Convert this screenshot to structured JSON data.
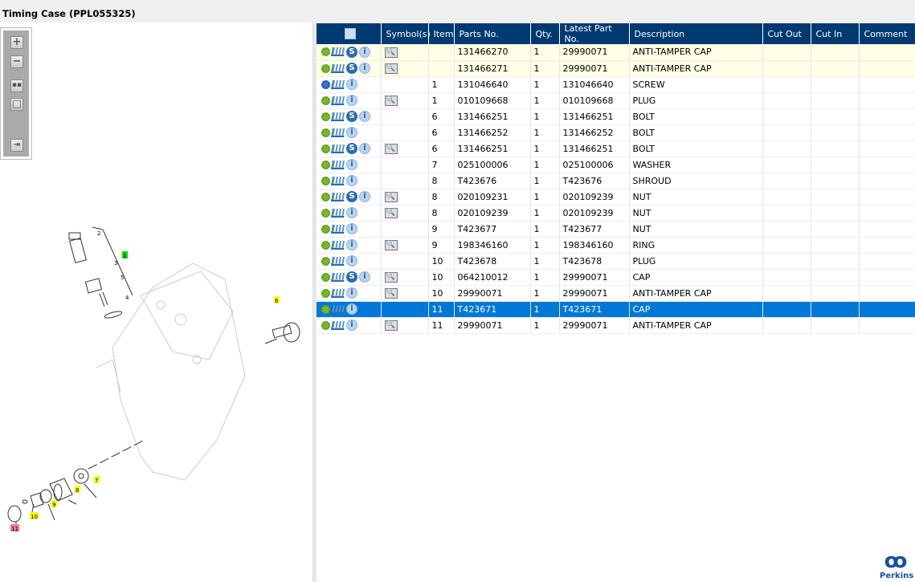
{
  "window": {
    "title": "Timing Case (PPL055325)"
  },
  "toolbar": {
    "buttons": [
      "zoom-in",
      "zoom-out",
      "fit-all",
      "fit-window",
      "toggle-panel"
    ]
  },
  "diagram": {
    "callouts": [
      {
        "label": "1",
        "color": "#00e000"
      },
      {
        "label": "2",
        "color": ""
      },
      {
        "label": "3",
        "color": ""
      },
      {
        "label": "4",
        "color": ""
      },
      {
        "label": "5",
        "color": ""
      },
      {
        "label": "6",
        "color": "#ffff00"
      },
      {
        "label": "7",
        "color": "#ffff00"
      },
      {
        "label": "8",
        "color": "#ffff00"
      },
      {
        "label": "9",
        "color": "#ffff00"
      },
      {
        "label": "10",
        "color": "#ffff00"
      },
      {
        "label": "11",
        "color": "#f08080"
      }
    ]
  },
  "table": {
    "columns": [
      "",
      "Symbol(s)",
      "Item",
      "Parts No.",
      "Qty.",
      "Latest Part No.",
      "Description",
      "Cut Out",
      "Cut In",
      "Comment"
    ],
    "rows": [
      {
        "gear": "green",
        "s": true,
        "sym": true,
        "item": "",
        "part": "131466270",
        "qty": "1",
        "latest": "29990071",
        "desc": "ANTI-TAMPER CAP",
        "hl": true
      },
      {
        "gear": "green",
        "s": true,
        "sym": true,
        "item": "",
        "part": "131466271",
        "qty": "1",
        "latest": "29990071",
        "desc": "ANTI-TAMPER CAP",
        "hl": true
      },
      {
        "gear": "blue",
        "s": false,
        "sym": false,
        "item": "1",
        "part": "131046640",
        "qty": "1",
        "latest": "131046640",
        "desc": "SCREW"
      },
      {
        "gear": "green",
        "s": false,
        "sym": true,
        "item": "1",
        "part": "010109668",
        "qty": "1",
        "latest": "010109668",
        "desc": "PLUG"
      },
      {
        "gear": "green",
        "s": true,
        "sym": false,
        "item": "6",
        "part": "131466251",
        "qty": "1",
        "latest": "131466251",
        "desc": "BOLT"
      },
      {
        "gear": "green",
        "s": false,
        "sym": false,
        "item": "6",
        "part": "131466252",
        "qty": "1",
        "latest": "131466252",
        "desc": "BOLT"
      },
      {
        "gear": "green",
        "s": true,
        "sym": true,
        "item": "6",
        "part": "131466251",
        "qty": "1",
        "latest": "131466251",
        "desc": "BOLT"
      },
      {
        "gear": "green",
        "s": false,
        "sym": false,
        "item": "7",
        "part": "025100006",
        "qty": "1",
        "latest": "025100006",
        "desc": "WASHER"
      },
      {
        "gear": "green",
        "s": false,
        "sym": false,
        "item": "8",
        "part": "T423676",
        "qty": "1",
        "latest": "T423676",
        "desc": "SHROUD"
      },
      {
        "gear": "green",
        "s": true,
        "sym": true,
        "item": "8",
        "part": "020109231",
        "qty": "1",
        "latest": "020109239",
        "desc": "NUT"
      },
      {
        "gear": "green",
        "s": false,
        "sym": true,
        "item": "8",
        "part": "020109239",
        "qty": "1",
        "latest": "020109239",
        "desc": "NUT"
      },
      {
        "gear": "green",
        "s": false,
        "sym": false,
        "item": "9",
        "part": "T423677",
        "qty": "1",
        "latest": "T423677",
        "desc": "NUT"
      },
      {
        "gear": "green",
        "s": false,
        "sym": true,
        "item": "9",
        "part": "198346160",
        "qty": "1",
        "latest": "198346160",
        "desc": "RING"
      },
      {
        "gear": "green",
        "s": false,
        "sym": false,
        "item": "10",
        "part": "T423678",
        "qty": "1",
        "latest": "T423678",
        "desc": "PLUG"
      },
      {
        "gear": "green",
        "s": true,
        "sym": true,
        "item": "10",
        "part": "064210012",
        "qty": "1",
        "latest": "29990071",
        "desc": "CAP"
      },
      {
        "gear": "green",
        "s": false,
        "sym": true,
        "item": "10",
        "part": "29990071",
        "qty": "1",
        "latest": "29990071",
        "desc": "ANTI-TAMPER CAP"
      },
      {
        "gear": "green",
        "s": false,
        "sym": false,
        "item": "11",
        "part": "T423671",
        "qty": "1",
        "latest": "T423671",
        "desc": "CAP",
        "selected": true
      },
      {
        "gear": "green",
        "s": false,
        "sym": true,
        "item": "11",
        "part": "29990071",
        "qty": "1",
        "latest": "29990071",
        "desc": "ANTI-TAMPER CAP"
      }
    ]
  },
  "logo": {
    "text": "Perkins"
  },
  "colors": {
    "header": "#003a70",
    "selected": "#0078d7",
    "highlight": "#fefde6"
  }
}
